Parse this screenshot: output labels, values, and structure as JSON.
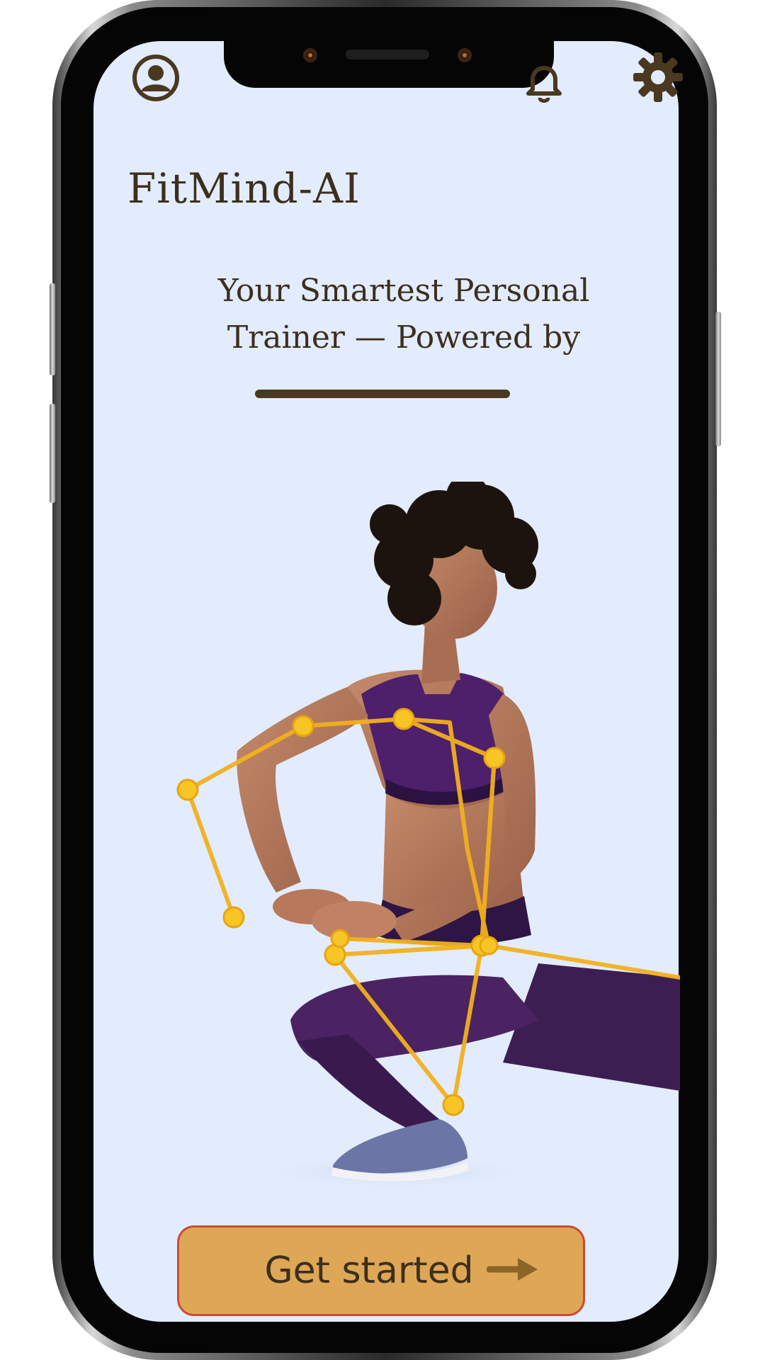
{
  "app": {
    "title": "FitMind-AI",
    "tagline": "Your Smartest Personal\nTrainer — Powered by"
  },
  "header": {
    "left_icon": "profile-icon",
    "right_icons": [
      "bell-icon",
      "gear-icon"
    ]
  },
  "hero": {
    "image_subject": "athlete-with-pose-skeleton-overlay"
  },
  "cta": {
    "label": "Get started",
    "icon": "arrow-right-icon"
  },
  "colors": {
    "screen_background": "#e2ecfd",
    "text_brown": "#3c2f1c",
    "button_fill": "#dea755",
    "button_border": "#cc4c34",
    "skeleton": "#f4b21e"
  }
}
